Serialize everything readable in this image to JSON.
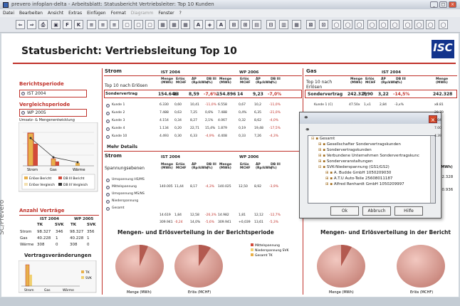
{
  "window": {
    "title": "prevero infoplan-delta - Arbeitsblatt: Statusbericht Vertriebsleiter: Top 10 Kunden"
  },
  "menu": [
    "Datei",
    "Bearbeiten",
    "Ansicht",
    "Extras",
    "Einfügen",
    "Format",
    "Diagramm",
    "Fenster",
    "?"
  ],
  "report": {
    "title": "Statusbericht: Vertriebsleitung Top 10",
    "logo": "ISC"
  },
  "left": {
    "berichtsperiode_label": "Berichtsperiode",
    "berichtsperiode_value": "IST 2004",
    "vergleich_label": "Vergleichsperiode",
    "vergleich_value": "WP 2005",
    "chart_title": "Umsatz- & Mengenentwicklung",
    "chart_cats": [
      "Strom",
      "Gas",
      "Wärme"
    ],
    "legend": [
      "Erlöse Bericht",
      "DB III Bericht",
      "Erlöse Vergleich",
      "DB III Vergleich"
    ],
    "vertraege_title": "Anzahl Verträge",
    "vt_head1": [
      "IST 2004",
      "WP 2005"
    ],
    "vt_head2": [
      "TK",
      "SVK",
      "TK",
      "SVK"
    ],
    "vt_rows": [
      [
        "Strom",
        "98.327",
        "346",
        "98.327",
        "356"
      ],
      [
        "Gas",
        "40.228",
        "1",
        "40.228",
        "1"
      ],
      [
        "Wärme",
        "308",
        "0",
        "308",
        "0"
      ]
    ],
    "vae_title": "Vertragsveränderungen",
    "vae_cats": [
      "Strom",
      "Gas",
      "Wärme"
    ],
    "vae_legend": [
      "TK",
      "SVK"
    ]
  },
  "strom": {
    "title": "Strom",
    "period1": "IST 2004",
    "period2": "WP 2006",
    "subtitle": "Top 10 nach Erlösen",
    "cols": [
      "Menge (MWh)",
      "Erlös MCHF",
      "ÄP (Rp/kWh)",
      "DB III (%)",
      "Menge (MWh)",
      "Erlös MCHF",
      "ÄP (Rp/kWh)",
      "DB III (%)"
    ],
    "sonder": [
      "Sondervertrag",
      "154.646",
      "13",
      "8,59",
      "-7,6%",
      "154.896",
      "14",
      "9,23",
      "-7,0%"
    ],
    "rows": [
      [
        "Kunde 1",
        "6.330",
        "0,60",
        "10,41",
        "-11,0%",
        "6.558",
        "0,67",
        "10,2",
        "-11,0%"
      ],
      [
        "Kunde 2",
        "7.488",
        "0,63",
        "7,25",
        "0,6%",
        "7.488",
        "0,4%",
        "6,35",
        "-21,0%"
      ],
      [
        "Kunde 3",
        "4.154",
        "0,34",
        "8,27",
        "2,1%",
        "4.067",
        "0,32",
        "8,62",
        "-4,0%"
      ],
      [
        "Kunde 4",
        "1.134",
        "0,20",
        "22,71",
        "15,4%",
        "1.879",
        "0,19",
        "19,48",
        "-17,5%"
      ],
      [
        "Kunde 10",
        "4.493",
        "0,30",
        "6,33",
        "-4,9%",
        "4.408",
        "0,33",
        "7,26",
        "-4,3%"
      ]
    ],
    "more": "Mehr Details",
    "sub2": "Spannungsebenen",
    "rows2": [
      [
        "Umspannung HS/MS",
        "",
        "",
        "",
        "",
        "",
        "",
        "",
        ""
      ],
      [
        "Mittelspannung",
        "140.005",
        "11,44",
        "8,17",
        "-4,3%",
        "140.025",
        "12,50",
        "8,92",
        "-3,9%"
      ],
      [
        "Umspannung MS/NS",
        "",
        "",
        "",
        "",
        "",
        "",
        "",
        ""
      ],
      [
        "Niederspannung",
        "",
        "",
        "",
        "",
        "",
        "",
        "",
        ""
      ],
      [
        "Gesamt",
        "",
        "",
        "",
        "",
        "",
        "",
        "",
        ""
      ],
      [
        "",
        "14.619",
        "1,84",
        "12,58",
        "-26,3%",
        "14.982",
        "1,81",
        "12,12",
        "-12,7%"
      ],
      [
        "",
        "309.941",
        "-0,24",
        "14,0%",
        "-5,6%",
        "309.941",
        "+0,039",
        "13,61",
        "-5,3%"
      ]
    ]
  },
  "gas": {
    "title": "Gas",
    "period": "IST 2004",
    "subtitle": "Top 10 nach Erlösen",
    "cols": [
      "Menge (MWh)",
      "Erlös MCHF",
      "ÄP (Rp/kWh)",
      "DB III (%)",
      "Menge (MWh)"
    ],
    "sonder": [
      "Sondervertrag",
      "242.329",
      "7,90",
      "3,22",
      "-14,5%",
      "242.328"
    ],
    "rows": [
      [
        "Kunde 1 (C)",
        "47.50x",
        "1,x1",
        "2,84",
        "-3,x%",
        "x8.81"
      ],
      [
        "",
        "",
        "",
        "",
        "",
        "28.79"
      ],
      [
        "",
        "",
        "",
        "",
        "",
        "5.04"
      ],
      [
        "",
        "",
        "",
        "",
        "",
        "7.00"
      ],
      [
        "",
        "",
        "",
        "",
        "",
        "4.39"
      ]
    ],
    "right_vals": [
      "42.328",
      "20.936"
    ],
    "right_head": "(MWh)"
  },
  "pies": {
    "title_left": "Mengen- und Erlösverteilung in der Berichtsperiode",
    "title_right": "Mengen- und Erlösverteilung in der Bericht",
    "legend": [
      "Mittelspannung",
      "Niederspannung SVK",
      "Gesamt TK"
    ],
    "labels": [
      "Menge (MWh)",
      "Erlös (MCHF)",
      "Menge (MWh)",
      "Erlös (MCHF)"
    ]
  },
  "dialog": {
    "tree": [
      "Gesamt",
      "Gesellschafter Sondervertragskunden",
      "Sondervertragskunden",
      "Verbundene Unternehmen Sondervertragskunc",
      "Sonderveranstaltungen",
      "SVK-Niederspannung (GS1/GS2)",
      "A. Budde GmbH 1050209030",
      "A.T.U Auto-Teile 25608011187",
      "Alfred Renhardt GmbH 1050209997"
    ],
    "ok": "Ok",
    "cancel": "Abbruch",
    "help": "Hilfe"
  },
  "credit": "SC/Prevero"
}
